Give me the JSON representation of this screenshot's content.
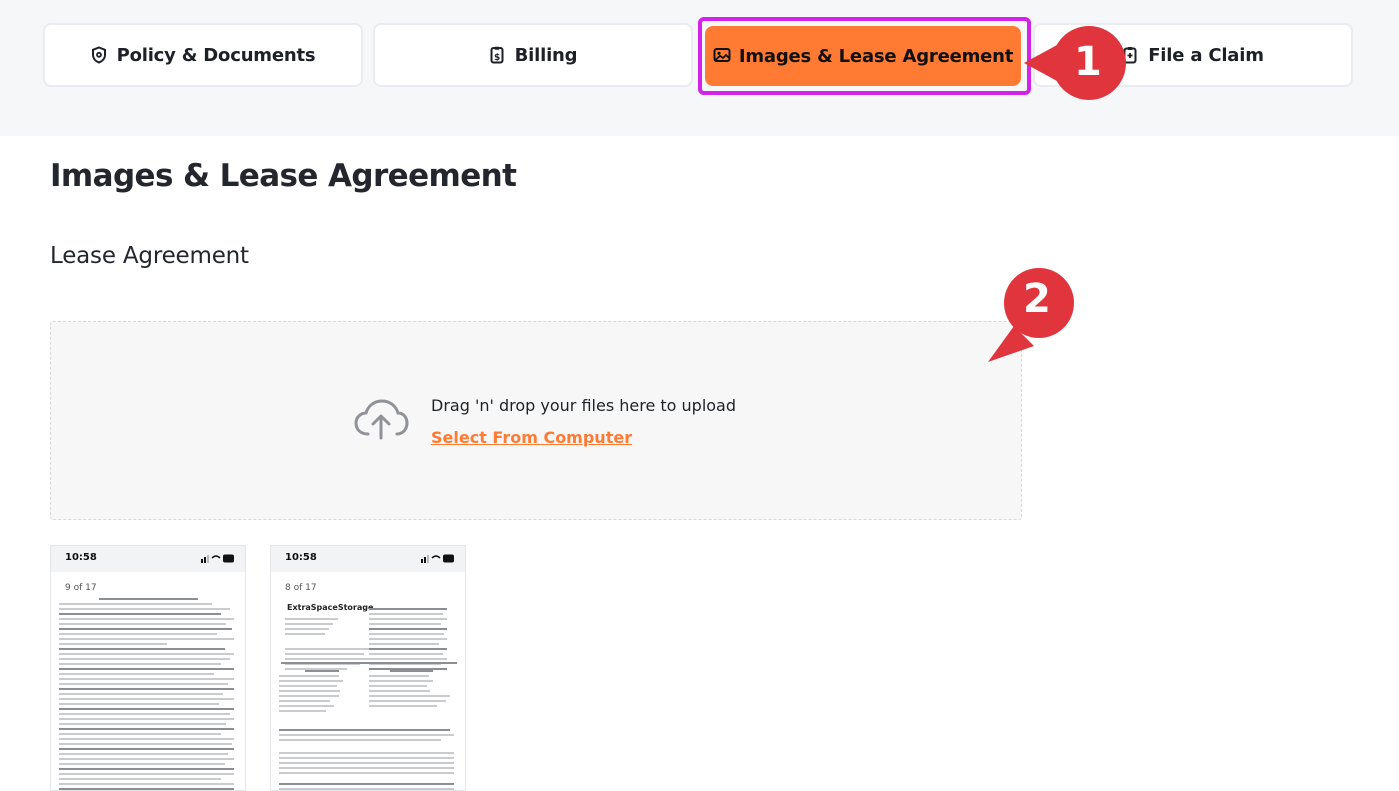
{
  "tabs": [
    {
      "label": "Policy & Documents",
      "icon": "shield-icon"
    },
    {
      "label": "Billing",
      "icon": "receipt-dollar-icon"
    },
    {
      "label": "Images & Lease Agreement",
      "icon": "image-icon",
      "active": true
    },
    {
      "label": "File a Claim",
      "icon": "clipboard-icon"
    }
  ],
  "annotations": {
    "marker_1": "1",
    "marker_2": "2"
  },
  "page": {
    "title": "Images & Lease Agreement",
    "section_title": "Lease Agreement"
  },
  "upload": {
    "prompt": "Drag 'n' drop your files here to upload",
    "link_label": "Select From Computer",
    "icon": "cloud-upload-icon"
  },
  "thumbnails": [
    {
      "time": "10:58",
      "page_counter": "9 of 17"
    },
    {
      "time": "10:58",
      "page_counter": "8 of 17",
      "brand": "ExtraSpaceStorage."
    }
  ],
  "colors": {
    "accent": "#ff7a33",
    "highlight": "#d323e8",
    "marker": "#e0353d"
  }
}
